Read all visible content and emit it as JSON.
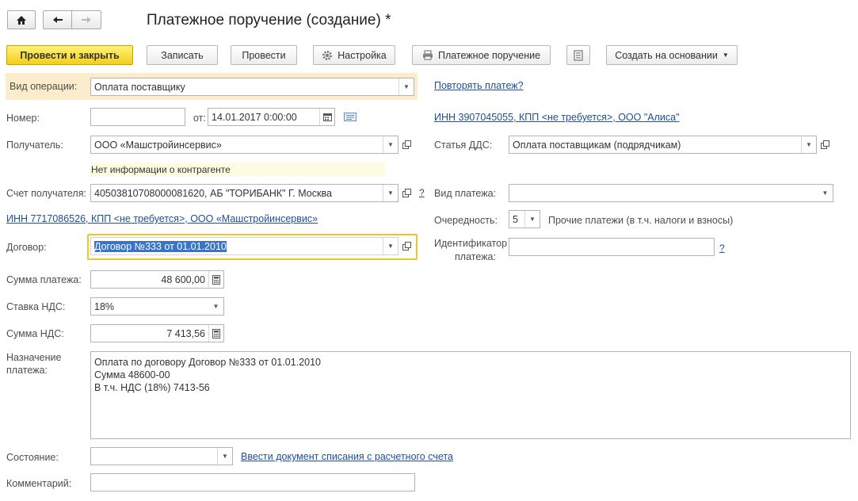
{
  "title": "Платежное поручение (создание) *",
  "toolbar": {
    "post_close": "Провести и закрыть",
    "save": "Записать",
    "post": "Провести",
    "settings": "Настройка",
    "print": "Платежное поручение",
    "create_based": "Создать на основании"
  },
  "operation": {
    "label": "Вид операции:",
    "value": "Оплата поставщику"
  },
  "repeat_link": "Повторять платеж?",
  "number": {
    "label": "Номер:",
    "value": "",
    "date_label": "от:",
    "date_value": "14.01.2017  0:00:00"
  },
  "org_inn_link": "ИНН 3907045055, КПП <не требуется>, ООО \"Алиса\"",
  "recipient": {
    "label": "Получатель:",
    "value": "ООО «Машстройинсервис»",
    "info": "Нет информации о контрагенте"
  },
  "dds": {
    "label": "Статья ДДС:",
    "value": "Оплата поставщикам (подрядчикам)"
  },
  "account": {
    "label": "Счет получателя:",
    "value": "40503810708000081620, АБ \"ТОРИБАНК\" Г. Москва",
    "help": "?"
  },
  "payment_type": {
    "label": "Вид платежа:",
    "value": ""
  },
  "recipient_inn_link": "ИНН 7717086526, КПП <не требуется>, ООО «Машстройинсервис»",
  "priority": {
    "label": "Очередность:",
    "value": "5",
    "desc": "Прочие платежи (в т.ч. налоги и взносы)"
  },
  "contract": {
    "label": "Договор:",
    "value": "Договор №333 от 01.01.2010"
  },
  "payment_id": {
    "label_line1": "Идентификатор",
    "label_line2": "платежа:",
    "value": "",
    "help": "?"
  },
  "amount": {
    "label": "Сумма платежа:",
    "value": "48 600,00"
  },
  "vat_rate": {
    "label": "Ставка НДС:",
    "value": "18%"
  },
  "vat_amount": {
    "label": "Сумма НДС:",
    "value": "7 413,56"
  },
  "purpose": {
    "label_line1": "Назначение",
    "label_line2": "платежа:",
    "lines": [
      "Оплата по договору Договор №333 от 01.01.2010",
      "Сумма 48600-00",
      "В т.ч. НДС  (18%) 7413-56"
    ]
  },
  "state": {
    "label": "Состояние:",
    "value": "",
    "link": "Ввести документ списания с расчетного счета"
  },
  "comment": {
    "label": "Комментарий:",
    "value": ""
  },
  "colors": {
    "primary_button": "#f3cf1b",
    "highlight_row": "#fbeccb",
    "info_bg": "#fdfbe0",
    "focus_border": "#f0c620",
    "link": "#1c4f9c"
  }
}
